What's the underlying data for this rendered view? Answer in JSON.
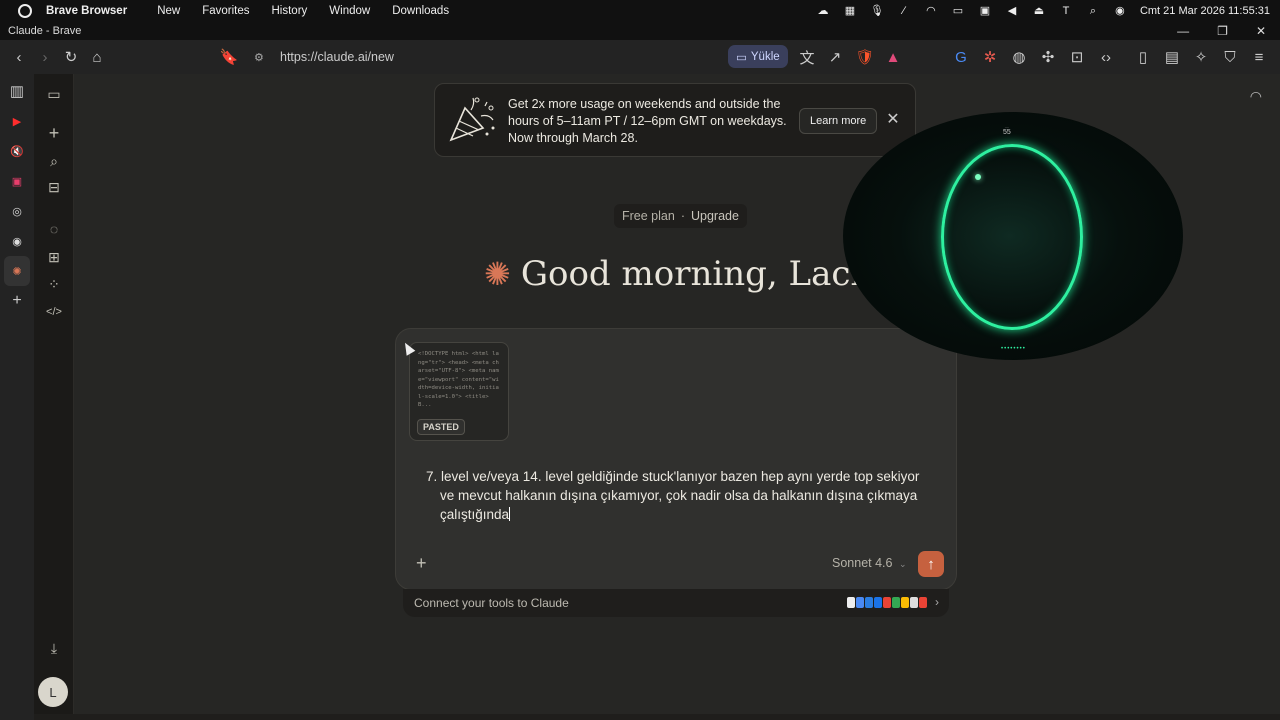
{
  "menubar": {
    "app_name": "Brave Browser",
    "items": [
      "New",
      "Favorites",
      "History",
      "Window",
      "Downloads"
    ],
    "clock": "Cmt 21 Mar 2026  11:55:31"
  },
  "window": {
    "title": "Claude - Brave"
  },
  "toolbar": {
    "url": "https://claude.ai/new",
    "yukle_label": "Yükle"
  },
  "banner": {
    "text": "Get 2x more usage on weekends and outside the hours of 5–11am PT / 12–6pm GMT on weekdays. Now through March 28.",
    "learn_more": "Learn more"
  },
  "plan": {
    "label": "Free plan",
    "separator": "·",
    "upgrade": "Upgrade"
  },
  "greeting": "Good morning, Lachin",
  "composer": {
    "pasted_preview": "<!DOCTYPE html> <html lang=\"tr\"> <head> <meta charset=\"UTF-8\"> <meta name=\"viewport\" content=\"width=device-width, initial-scale=1.0\"> <title>B...",
    "pasted_badge": "PASTED",
    "line1": "7. level ve/veya 14. level geldiğinde stuck'lanıyor bazen hep aynı yerde top sekiyor",
    "line2": "ve mevcut halkanın dışına çıkamıyor, çok nadir olsa da halkanın dışına çıkmaya",
    "line3": "çalıştığında",
    "model": "Sonnet 4.6"
  },
  "connect": {
    "label": "Connect your tools to Claude"
  },
  "sidebar": {
    "avatar_initial": "L"
  },
  "game_overlay": {
    "score": "55"
  },
  "colors": {
    "accent": "#d97757",
    "send": "#c6613f",
    "ring": "#2ef0a0"
  }
}
